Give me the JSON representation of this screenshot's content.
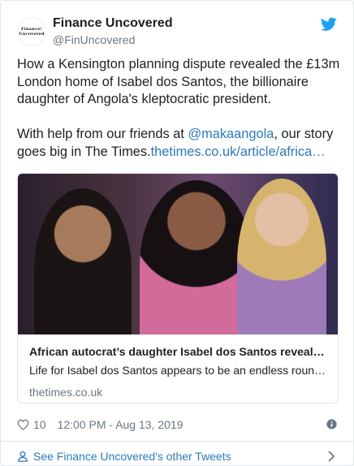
{
  "account": {
    "display_name": "Finance Uncovered",
    "handle": "@FinUncovered",
    "avatar_line1": "Finance!",
    "avatar_line2": "Uncovered"
  },
  "tweet": {
    "para1": "How a Kensington planning dispute revealed the £13m London home of Isabel dos Santos, the billionaire daughter of Angola's kleptocratic president.",
    "para2_prefix": "With help from our friends at ",
    "mention": "@makaangola",
    "para2_mid": ", our story goes big in The Times.",
    "url": "thetimes.co.uk/article/africa…"
  },
  "link_card": {
    "title": "African autocrat’s daughter Isabel dos Santos reveal…",
    "description": "Life for Isabel dos Santos appears to be an endless roun…",
    "domain": "thetimes.co.uk"
  },
  "meta": {
    "likes": "10",
    "timestamp": "12:00 PM - Aug 13, 2019"
  },
  "footer": {
    "label": "See Finance Uncovered's other Tweets"
  },
  "colors": {
    "link": "#2b7bb9",
    "muted": "#697882",
    "twitter_blue": "#1da1f2"
  }
}
